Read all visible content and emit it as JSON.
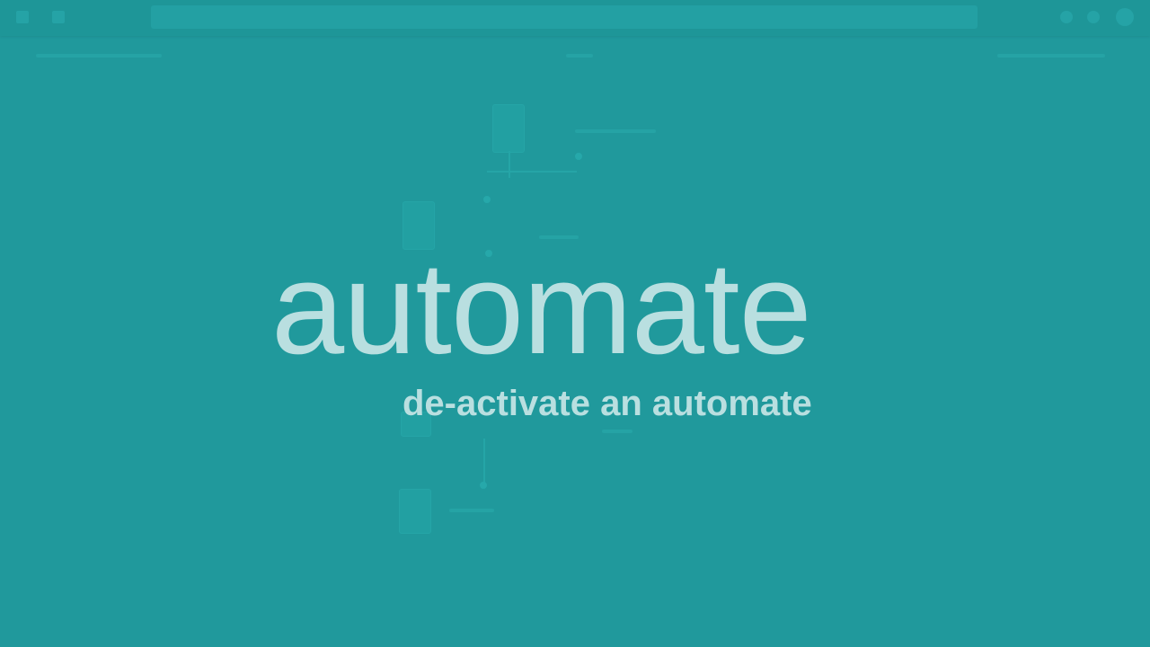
{
  "overlay": {
    "title": "automate",
    "subtitle": "de-activate an automate"
  },
  "colors": {
    "background": "#20999c",
    "text": "#b9dfe0"
  }
}
